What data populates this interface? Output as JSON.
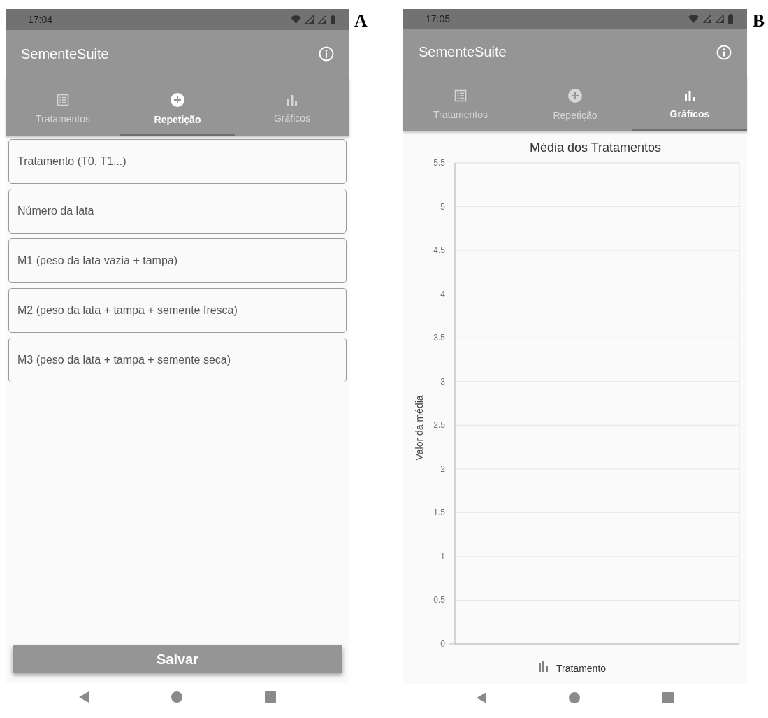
{
  "panels": [
    {
      "kind": "form",
      "label": "A",
      "status_bar": {
        "time": "17:04"
      },
      "app_bar": {
        "title": "SementeSuite"
      },
      "tabs": [
        {
          "label": "Tratamentos",
          "selected": false
        },
        {
          "label": "Repetição",
          "selected": true
        },
        {
          "label": "Gráficos",
          "selected": false
        }
      ],
      "fields": [
        {
          "placeholder": "Tratamento (T0, T1...)"
        },
        {
          "placeholder": "Número da lata"
        },
        {
          "placeholder": "M1 (peso da lata vazia + tampa)"
        },
        {
          "placeholder": "M2 (peso da lata + tampa + semente fresca)"
        },
        {
          "placeholder": "M3 (peso da lata + tampa + semente seca)"
        }
      ],
      "button": "Salvar"
    },
    {
      "kind": "chart",
      "label": "B",
      "status_bar": {
        "time": "17:05"
      },
      "app_bar": {
        "title": "SementeSuite"
      },
      "tabs": [
        {
          "label": "Tratamentos",
          "selected": false
        },
        {
          "label": "Repetição",
          "selected": false
        },
        {
          "label": "Gráficos",
          "selected": true
        }
      ],
      "chart_data": {
        "type": "bar",
        "grid": true,
        "title": "Média dos Tratamentos",
        "ylabel": "Valor da média",
        "ylim": [
          0,
          5.5
        ],
        "yticks": [
          0,
          0.5,
          1,
          1.5,
          2,
          2.5,
          3,
          3.5,
          4,
          4.5,
          5,
          5.5
        ],
        "series": [
          {
            "name": "Tratamento",
            "color": "#808080"
          }
        ]
      }
    }
  ]
}
